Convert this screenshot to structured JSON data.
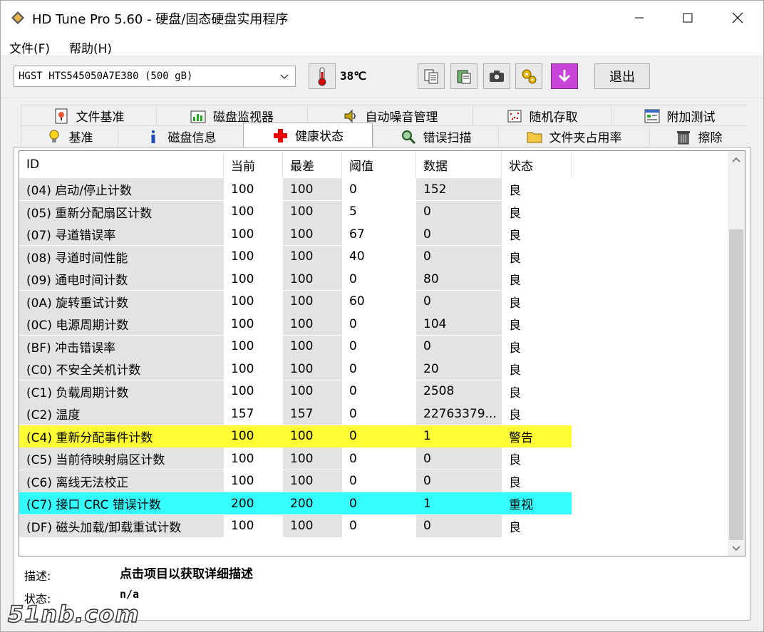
{
  "window": {
    "title": "HD Tune Pro 5.60 - 硬盘/固态硬盘实用程序"
  },
  "menu": {
    "file": "文件(F)",
    "help": "帮助(H)"
  },
  "toolbar": {
    "drive": "HGST HTS545050A7E380 (500 gB)",
    "temperature": "38℃",
    "exit_label": "退出"
  },
  "tabs_row1": [
    {
      "label": "文件基准",
      "icon": "file-benchmark-icon",
      "width": 190
    },
    {
      "label": "磁盘监视器",
      "icon": "disk-monitor-icon",
      "width": 212
    },
    {
      "label": "自动噪音管理",
      "icon": "speaker-icon",
      "width": 232
    },
    {
      "label": "随机存取",
      "icon": "random-access-icon",
      "width": 194
    },
    {
      "label": "附加测试",
      "icon": "extra-tests-icon",
      "width": 192
    }
  ],
  "tabs_row2": [
    {
      "label": "基准",
      "icon": "lightbulb-icon",
      "width": 136
    },
    {
      "label": "磁盘信息",
      "icon": "info-icon",
      "width": 176
    },
    {
      "label": "健康状态",
      "icon": "health-cross-icon",
      "width": 182,
      "active": true
    },
    {
      "label": "错误扫描",
      "icon": "magnifier-icon",
      "width": 176
    },
    {
      "label": "文件夹占用率",
      "icon": "folder-icon",
      "width": 212
    },
    {
      "label": "擦除",
      "icon": "trash-icon",
      "width": 138
    }
  ],
  "table": {
    "headers": [
      "ID",
      "当前",
      "最差",
      "阈值",
      "数据",
      "状态"
    ],
    "rows": [
      {
        "id": "(04) 启动/停止计数",
        "current": "100",
        "worst": "100",
        "threshold": "0",
        "data": "152",
        "status": "良"
      },
      {
        "id": "(05) 重新分配扇区计数",
        "current": "100",
        "worst": "100",
        "threshold": "5",
        "data": "0",
        "status": "良"
      },
      {
        "id": "(07) 寻道错误率",
        "current": "100",
        "worst": "100",
        "threshold": "67",
        "data": "0",
        "status": "良"
      },
      {
        "id": "(08) 寻道时间性能",
        "current": "100",
        "worst": "100",
        "threshold": "40",
        "data": "0",
        "status": "良"
      },
      {
        "id": "(09) 通电时间计数",
        "current": "100",
        "worst": "100",
        "threshold": "0",
        "data": "80",
        "status": "良"
      },
      {
        "id": "(0A) 旋转重试计数",
        "current": "100",
        "worst": "100",
        "threshold": "60",
        "data": "0",
        "status": "良"
      },
      {
        "id": "(0C) 电源周期计数",
        "current": "100",
        "worst": "100",
        "threshold": "0",
        "data": "104",
        "status": "良"
      },
      {
        "id": "(BF) 冲击错误率",
        "current": "100",
        "worst": "100",
        "threshold": "0",
        "data": "0",
        "status": "良"
      },
      {
        "id": "(C0) 不安全关机计数",
        "current": "100",
        "worst": "100",
        "threshold": "0",
        "data": "20",
        "status": "良"
      },
      {
        "id": "(C1) 负载周期计数",
        "current": "100",
        "worst": "100",
        "threshold": "0",
        "data": "2508",
        "status": "良"
      },
      {
        "id": "(C2) 温度",
        "current": "157",
        "worst": "157",
        "threshold": "0",
        "data": "22763379...",
        "status": "良"
      },
      {
        "id": "(C4) 重新分配事件计数",
        "current": "100",
        "worst": "100",
        "threshold": "0",
        "data": "1",
        "status": "警告",
        "highlight": "warn"
      },
      {
        "id": "(C5) 当前待映射扇区计数",
        "current": "100",
        "worst": "100",
        "threshold": "0",
        "data": "0",
        "status": "良"
      },
      {
        "id": "(C6) 离线无法校正",
        "current": "100",
        "worst": "100",
        "threshold": "0",
        "data": "0",
        "status": "良"
      },
      {
        "id": "(C7) 接口 CRC 错误计数",
        "current": "200",
        "worst": "200",
        "threshold": "0",
        "data": "1",
        "status": "重视",
        "highlight": "caution"
      },
      {
        "id": "(DF) 磁头加载/卸载重试计数",
        "current": "100",
        "worst": "100",
        "threshold": "0",
        "data": "0",
        "status": "良"
      }
    ]
  },
  "colors": {
    "warn": "#ffff33",
    "caution": "#33ffff"
  },
  "footer": {
    "desc_label": "描述:",
    "desc_value": "点击项目以获取详细描述",
    "status_label": "状态:",
    "status_value": "n/a"
  },
  "watermark": "51nb.com"
}
